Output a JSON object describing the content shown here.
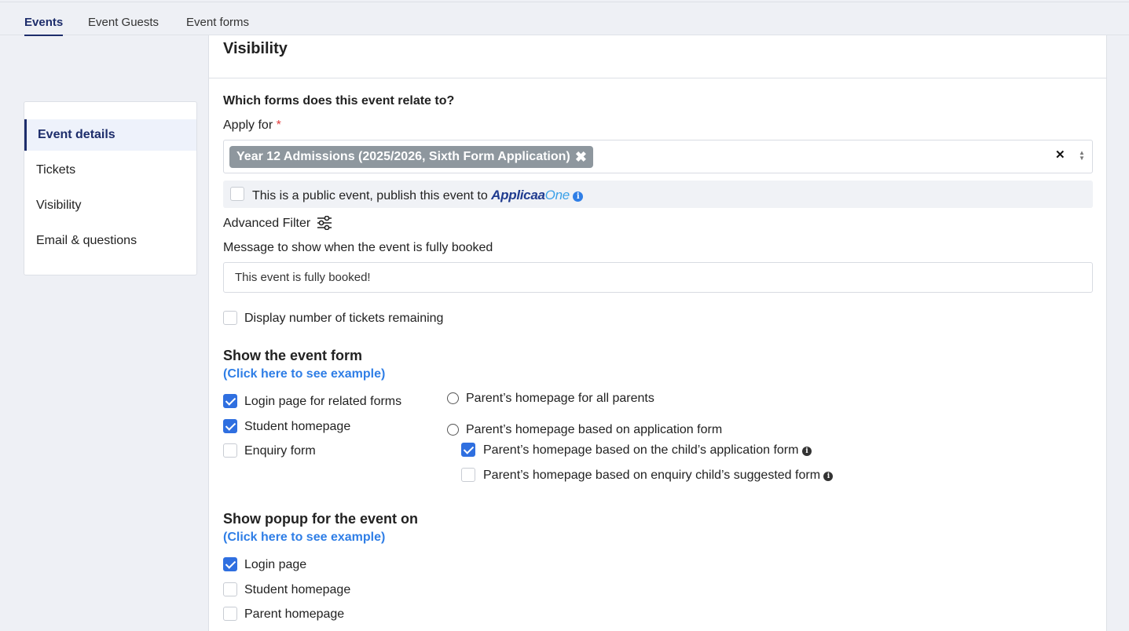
{
  "tabs": [
    {
      "label": "Events",
      "active": true
    },
    {
      "label": "Event Guests",
      "active": false
    },
    {
      "label": "Event forms",
      "active": false
    }
  ],
  "sidebar": {
    "items": [
      {
        "label": "Event details",
        "active": true
      },
      {
        "label": "Tickets",
        "active": false
      },
      {
        "label": "Visibility",
        "active": false
      },
      {
        "label": "Email & questions",
        "active": false
      }
    ]
  },
  "panel": {
    "title": "Visibility",
    "forms_question": "Which forms does this event relate to?",
    "apply_for_label": "Apply for",
    "required_mark": "*",
    "apply_for_selected": "Year 12 Admissions (2025/2026, Sixth Form Application)",
    "public_event_label": "This is a public event, publish this event to",
    "public_event_checked": false,
    "brand_part1": "Applicaa",
    "brand_part2": "One",
    "advanced_filter_label": "Advanced Filter",
    "fully_booked_label": "Message to show when the event is fully booked",
    "fully_booked_value": "This event is fully booked!",
    "display_tickets_label": "Display number of tickets remaining",
    "display_tickets_checked": false
  },
  "show_event_form": {
    "title": "Show the event form",
    "example_link": "(Click here to see example)",
    "left_options": [
      {
        "label": "Login page for related forms",
        "checked": true
      },
      {
        "label": "Student homepage",
        "checked": true
      },
      {
        "label": "Enquiry form",
        "checked": false
      }
    ],
    "radio_all_parents": "Parent’s homepage for all parents",
    "radio_based_on_form": "Parent’s homepage based on application form",
    "sub_options": [
      {
        "label": "Parent’s homepage based on the child’s application form",
        "checked": true
      },
      {
        "label": "Parent’s homepage based on enquiry child’s suggested form",
        "checked": false
      }
    ]
  },
  "show_popup": {
    "title": "Show popup for the event on",
    "example_link": "(Click here to see example)",
    "options": [
      {
        "label": "Login page",
        "checked": true
      },
      {
        "label": "Student homepage",
        "checked": false
      },
      {
        "label": "Parent homepage",
        "checked": false
      }
    ]
  },
  "colors": {
    "accent": "#1d2d6b",
    "checkbox": "#2f6fe0",
    "link": "#2f7ee6",
    "chip": "#8e979e"
  }
}
